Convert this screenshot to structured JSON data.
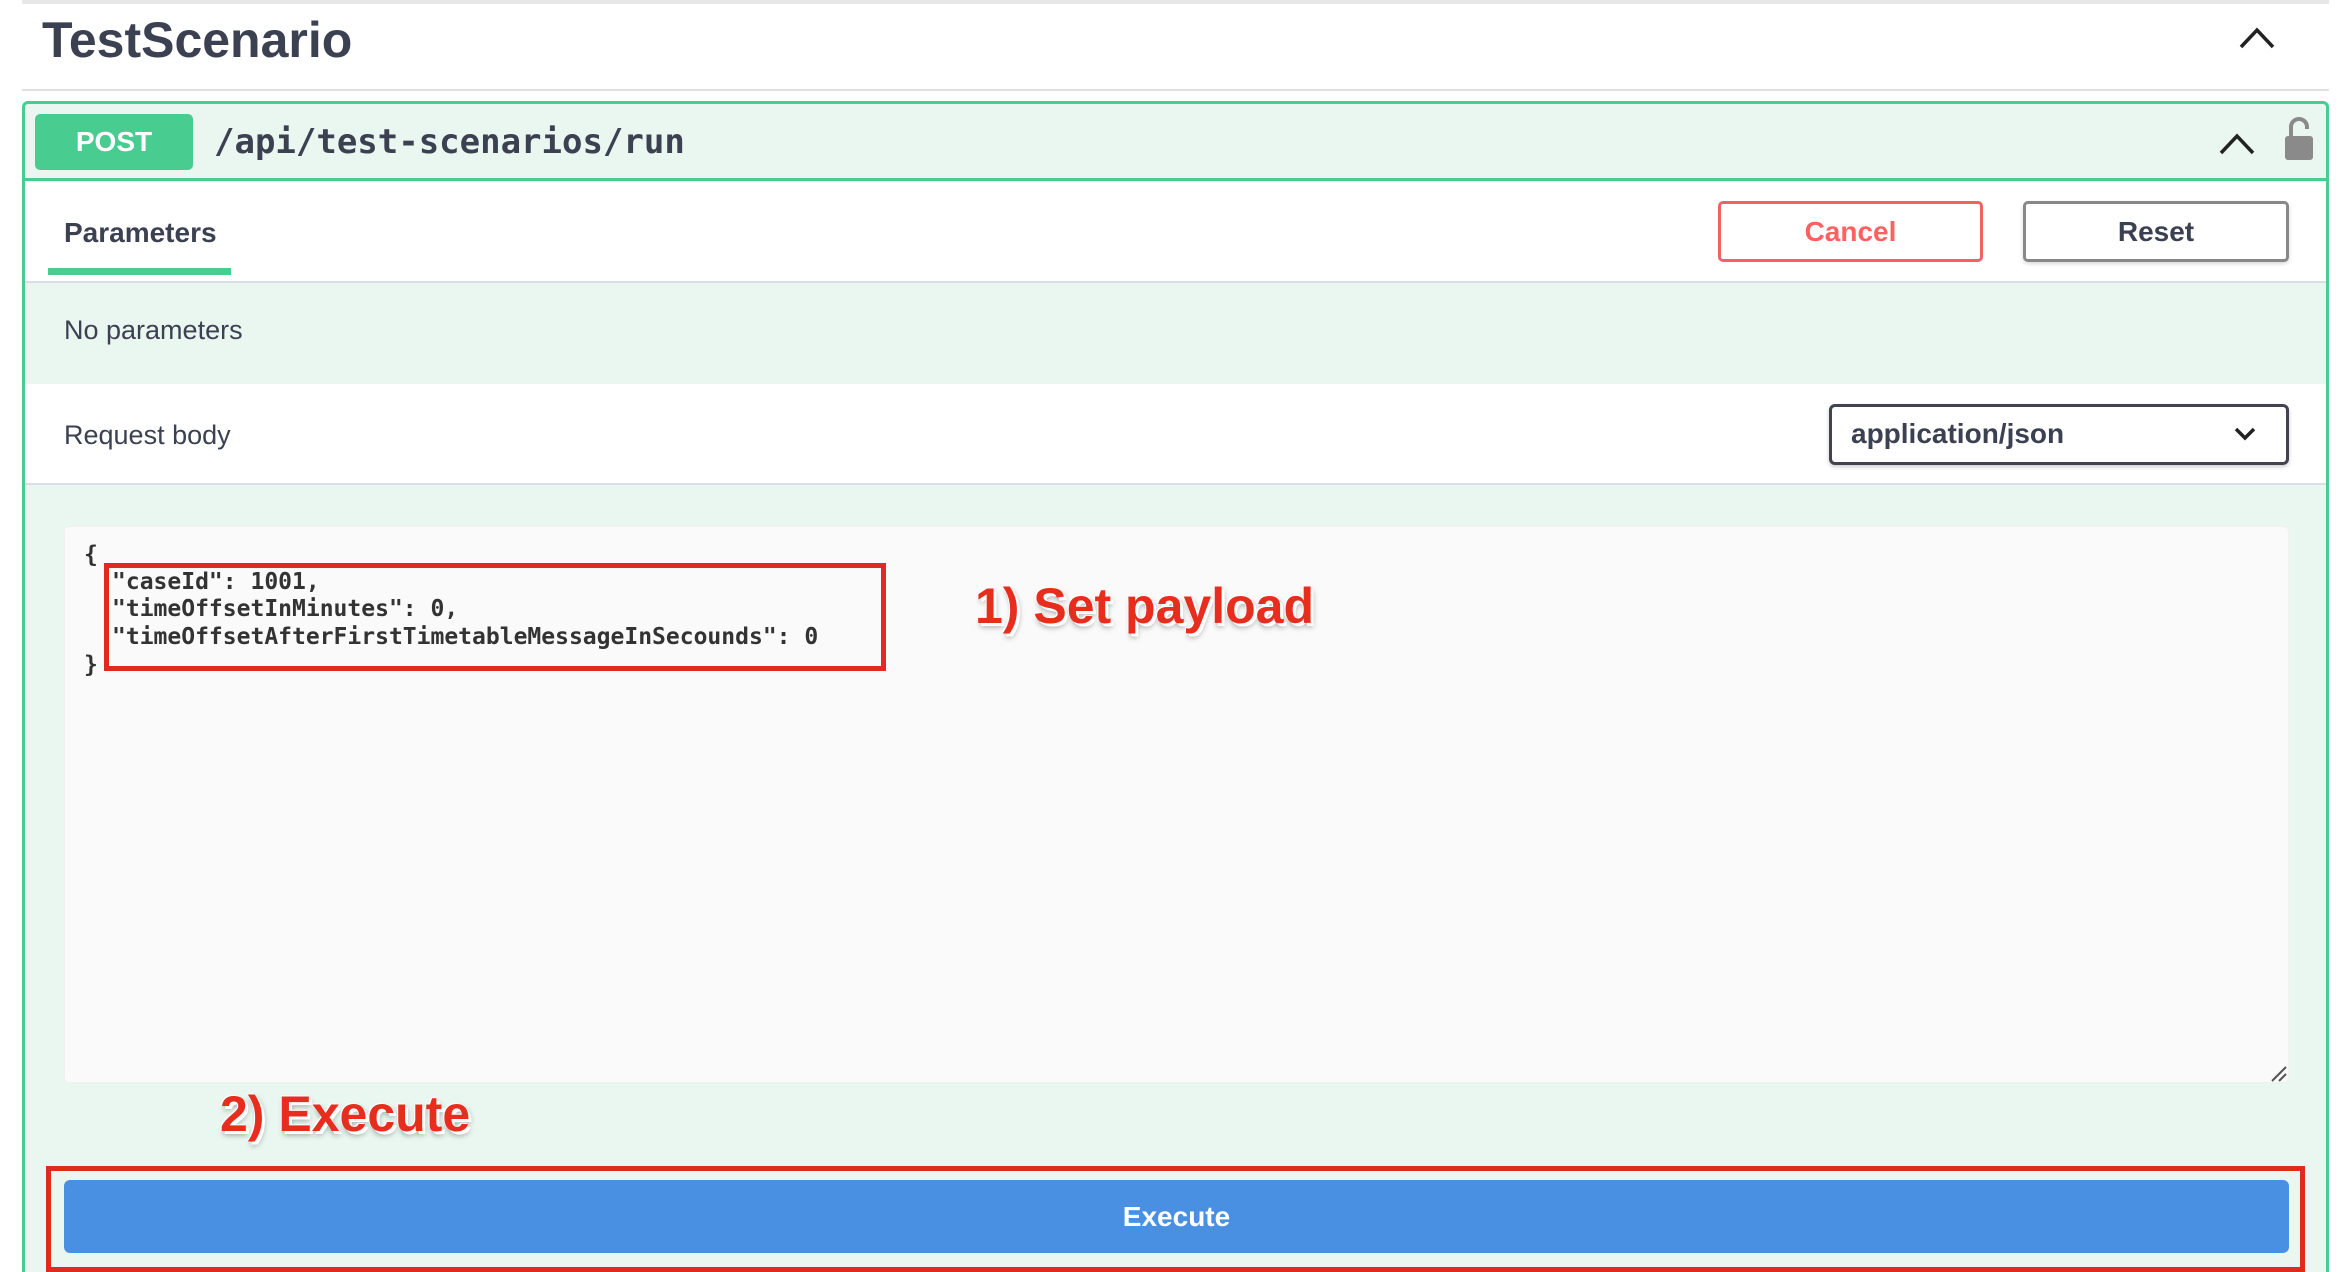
{
  "section": {
    "title": "TestScenario",
    "collapse_icon": "chevron-up-icon"
  },
  "operation": {
    "method": "POST",
    "path": "/api/test-scenarios/run",
    "collapse_icon": "chevron-up-icon",
    "lock_icon": "unlocked-padlock-icon",
    "method_color": "#49cc90"
  },
  "parameters_tab": {
    "label": "Parameters",
    "cancel_label": "Cancel",
    "reset_label": "Reset",
    "empty_text": "No parameters"
  },
  "request_body": {
    "label": "Request body",
    "content_type": "application/json",
    "code_lines": [
      "{",
      "\"caseId\": 1001,",
      "\"timeOffsetInMinutes\": 0,",
      "\"timeOffsetAfterFirstTimetableMessageInSecounds\": 0",
      "}"
    ]
  },
  "annotations": {
    "step1": "1) Set payload",
    "step2": "2) Execute",
    "color": "#e62d1e"
  },
  "execute": {
    "label": "Execute",
    "color": "#4990e2"
  }
}
